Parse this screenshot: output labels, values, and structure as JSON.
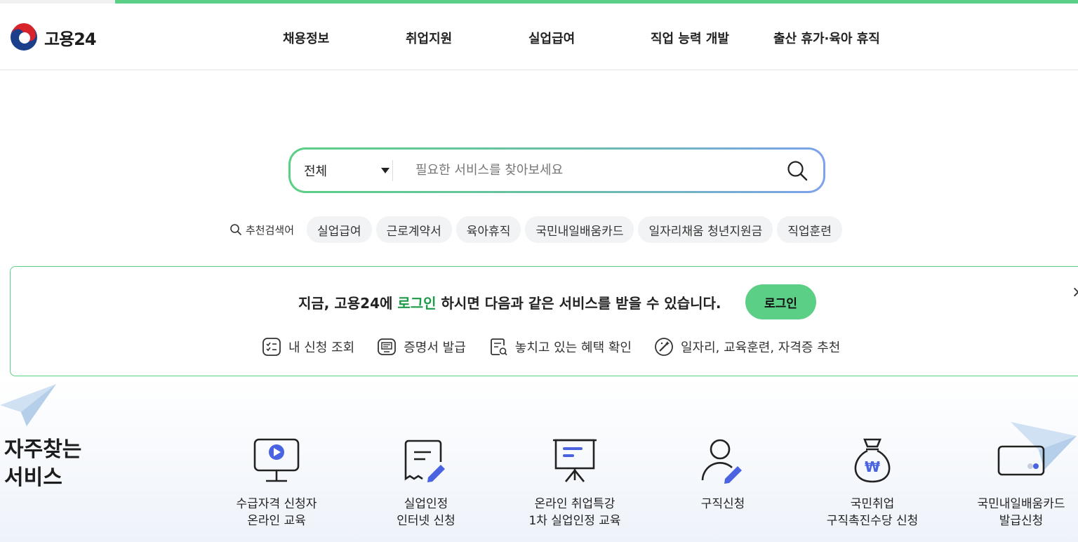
{
  "brand": {
    "name": "고용24"
  },
  "nav": [
    {
      "label": "채용정보"
    },
    {
      "label": "취업지원"
    },
    {
      "label": "실업급여"
    },
    {
      "label": "직업 능력 개발"
    },
    {
      "label": "출산 휴가·육아 휴직"
    }
  ],
  "search": {
    "category": "전체",
    "placeholder": "필요한 서비스를 찾아보세요",
    "icon": "search-icon"
  },
  "keywords": {
    "label": "추천검색어",
    "items": [
      "실업급여",
      "근로계약서",
      "육아휴직",
      "국민내일배움카드",
      "일자리채움 청년지원금",
      "직업훈련"
    ]
  },
  "login_banner": {
    "msg_prefix": "지금, 고용24에 ",
    "msg_highlight": "로그인",
    "msg_suffix": " 하시면 다음과 같은 서비스를 받을 수 있습니다.",
    "button": "로그인",
    "close": "×",
    "benefits": [
      {
        "label": "내 신청 조회",
        "icon": "checklist-icon"
      },
      {
        "label": "증명서 발급",
        "icon": "certificate-icon"
      },
      {
        "label": "놓치고 있는 혜택 확인",
        "icon": "document-search-icon"
      },
      {
        "label": "일자리, 교육훈련, 자격증 추천",
        "icon": "magic-wand-icon"
      }
    ]
  },
  "frequent": {
    "title_line1": "자주찾는",
    "title_line2": "서비스",
    "items": [
      {
        "line1": "수급자격 신청자",
        "line2": "온라인 교육",
        "icon": "video-monitor-icon"
      },
      {
        "line1": "실업인정",
        "line2": "인터넷 신청",
        "icon": "document-pen-icon"
      },
      {
        "line1": "온라인 취업특강",
        "line2": "1차 실업인정 교육",
        "icon": "presentation-board-icon"
      },
      {
        "line1": "구직신청",
        "line2": "",
        "icon": "person-pen-icon"
      },
      {
        "line1": "국민취업",
        "line2": "구직촉진수당 신청",
        "icon": "money-bag-icon"
      },
      {
        "line1": "국민내일배움카드",
        "line2": "발급신청",
        "icon": "card-icon"
      }
    ]
  },
  "colors": {
    "accent": "#5ccf86",
    "accent_blue": "#7ea2ec",
    "highlight_text": "#1f9a4a",
    "icon_blue": "#4a63e0"
  }
}
